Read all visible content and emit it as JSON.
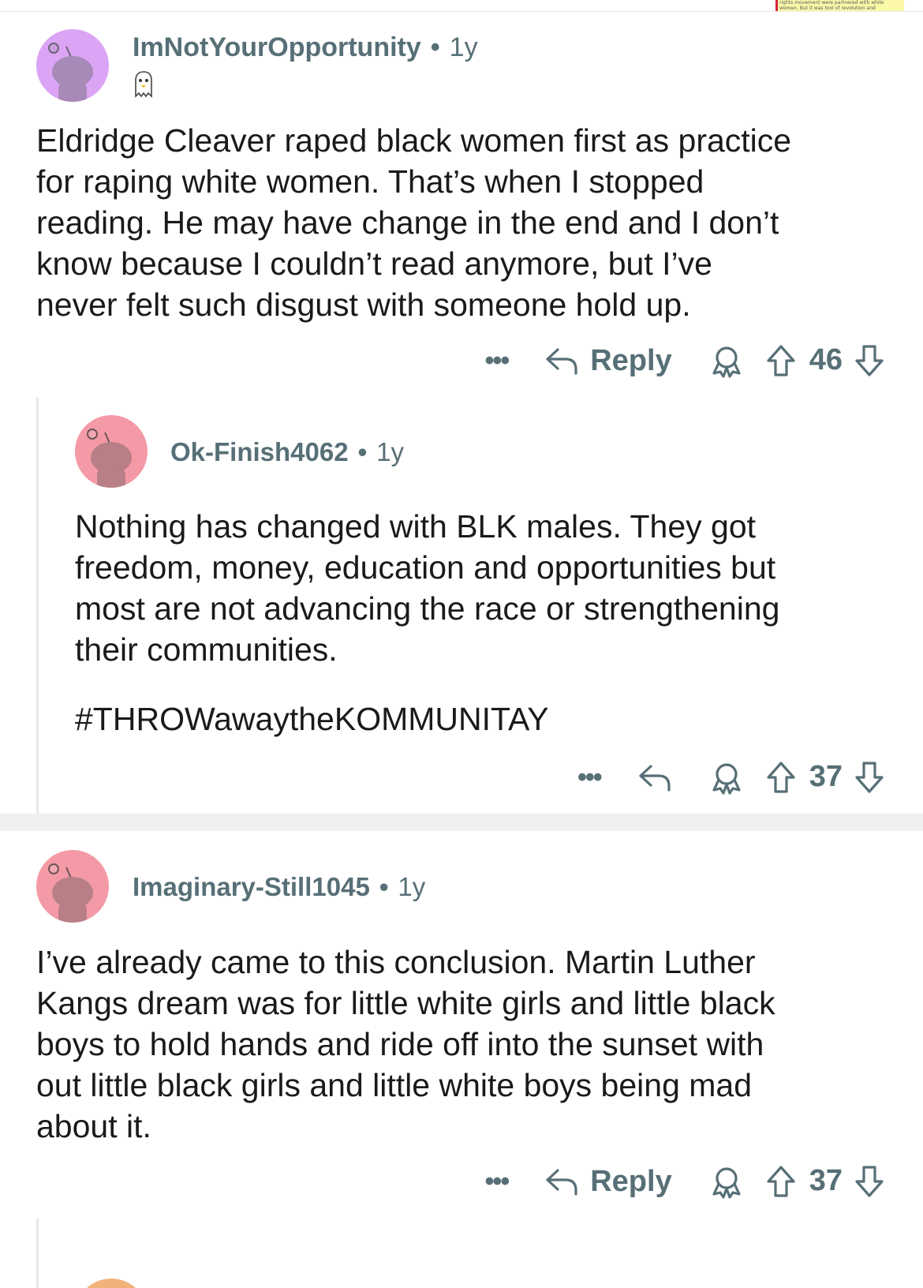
{
  "corner_snippet": {
    "line1": "rights movement were partnered with white",
    "line2": "women. But it was tool of revolution and"
  },
  "comments": [
    {
      "username": "ImNotYourOpportunity",
      "age": "1y",
      "avatar_color": "#dba4f5",
      "flair_icon": "ghost-flair-icon",
      "body": [
        "Eldridge Cleaver raped black women first as practice",
        "for raping white women. That’s when I stopped",
        "reading. He may have change in the end and I don’t",
        "know because I couldn’t read anymore, but I’ve",
        "never felt such disgust with someone hold up."
      ],
      "actions": {
        "more": "•••",
        "reply": "Reply",
        "score": "46"
      }
    },
    {
      "username": "Ok-Finish4062",
      "age": "1y",
      "avatar_color": "#f49aa6",
      "body": [
        "Nothing has changed with BLK males. They got",
        "freedom, money, education and opportunities but",
        "most are not advancing the race or strengthening",
        "their communities."
      ],
      "hashtag": "#THROWawaytheKOMMUNITAY",
      "actions": {
        "more": "•••",
        "score": "37"
      }
    },
    {
      "username": "Imaginary-Still1045",
      "age": "1y",
      "avatar_color": "#f49aa6",
      "body": [
        "I’ve already came to this conclusion. Martin Luther",
        "Kangs dream was for little white girls and little black",
        "boys to hold hands and ride off into the sunset with",
        "out little black girls and little white boys being mad",
        "about it."
      ],
      "actions": {
        "more": "•••",
        "reply": "Reply",
        "score": "37"
      }
    }
  ],
  "icons": {
    "avatar": "snoo-avatar-icon",
    "reply": "reply-arrow-icon",
    "award": "award-icon",
    "upvote": "upvote-arrow-icon",
    "downvote": "downvote-arrow-icon",
    "more": "more-options-icon"
  },
  "colors": {
    "text": "#1a1a1b",
    "meta": "#576f76",
    "thread_line": "#e6e8ea",
    "divider": "#eef0f2"
  }
}
